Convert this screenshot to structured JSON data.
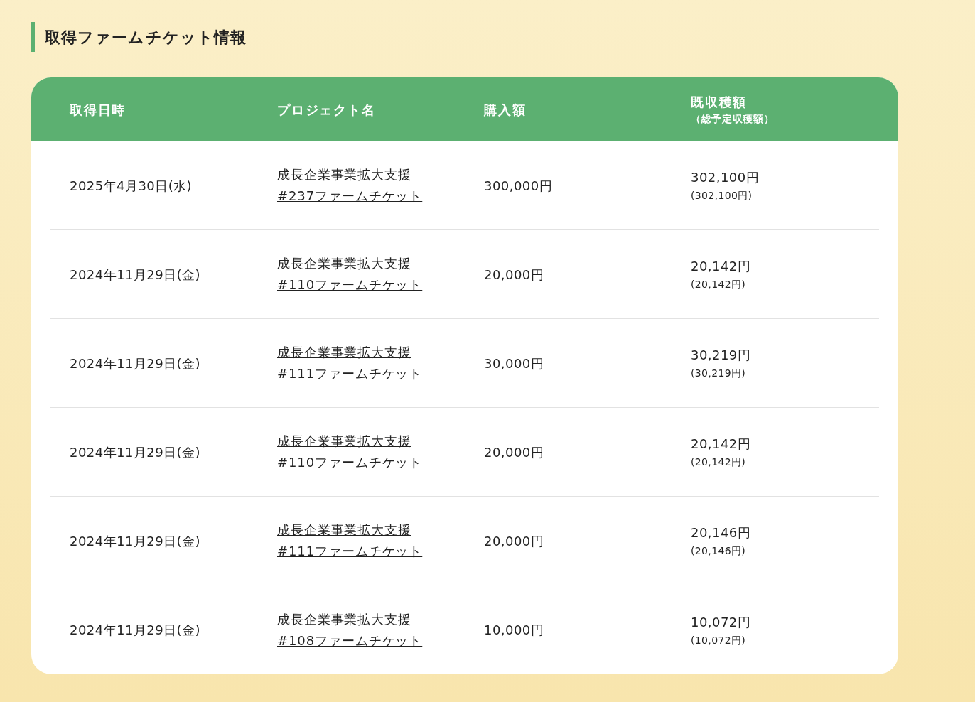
{
  "section_title": "取得ファームチケット情報",
  "table": {
    "columns": [
      {
        "label": "取得日時"
      },
      {
        "label": "プロジェクト名"
      },
      {
        "label": "購入額"
      },
      {
        "label": "既収穫額",
        "sublabel": "（総予定収穫額）"
      }
    ],
    "rows": [
      {
        "date": "2025年4月30日(水)",
        "project_line1": "成長企業事業拡大支援",
        "project_line2": "#237ファームチケット",
        "amount": "300,000円",
        "harvested": "302,100円",
        "planned": "(302,100円)"
      },
      {
        "date": "2024年11月29日(金)",
        "project_line1": "成長企業事業拡大支援",
        "project_line2": "#110ファームチケット",
        "amount": "20,000円",
        "harvested": "20,142円",
        "planned": "(20,142円)"
      },
      {
        "date": "2024年11月29日(金)",
        "project_line1": "成長企業事業拡大支援",
        "project_line2": "#111ファームチケット",
        "amount": "30,000円",
        "harvested": "30,219円",
        "planned": "(30,219円)"
      },
      {
        "date": "2024年11月29日(金)",
        "project_line1": "成長企業事業拡大支援",
        "project_line2": "#110ファームチケット",
        "amount": "20,000円",
        "harvested": "20,142円",
        "planned": "(20,142円)"
      },
      {
        "date": "2024年11月29日(金)",
        "project_line1": "成長企業事業拡大支援",
        "project_line2": "#111ファームチケット",
        "amount": "20,000円",
        "harvested": "20,146円",
        "planned": "(20,146円)"
      },
      {
        "date": "2024年11月29日(金)",
        "project_line1": "成長企業事業拡大支援",
        "project_line2": "#108ファームチケット",
        "amount": "10,000円",
        "harvested": "10,072円",
        "planned": "(10,072円)"
      }
    ]
  }
}
